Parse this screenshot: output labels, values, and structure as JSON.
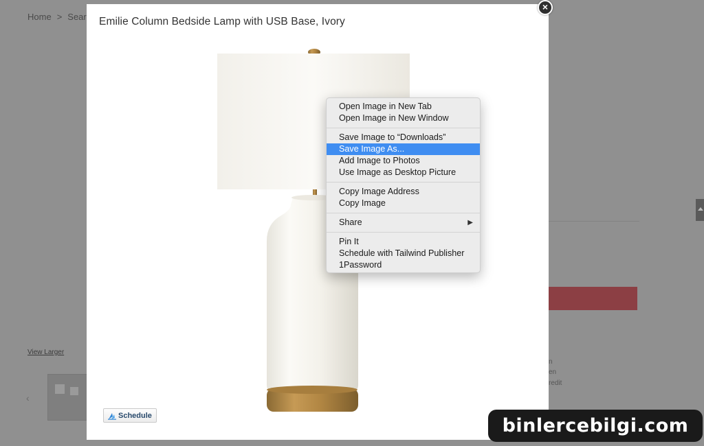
{
  "background": {
    "breadcrumb": [
      "Home",
      ">",
      "Sear"
    ],
    "view_larger": "View Larger",
    "thumb_prev": "‹",
    "side_text": [
      "n",
      "en",
      "redit"
    ],
    "accent_red": "#8c3f44"
  },
  "modal": {
    "title": "Emilie Column Bedside Lamp with USB Base, Ivory",
    "close_label": "×",
    "schedule_label": "Schedule"
  },
  "context_menu": {
    "groups": [
      [
        "Open Image in New Tab",
        "Open Image in New Window"
      ],
      [
        "Save Image to “Downloads”",
        "Save Image As...",
        "Add Image to Photos",
        "Use Image as Desktop Picture"
      ],
      [
        "Copy Image Address",
        "Copy Image"
      ],
      [
        "Share"
      ],
      [
        "Pin It",
        "Schedule with Tailwind Publisher",
        "1Password"
      ]
    ],
    "highlighted": "Save Image As...",
    "submenu_arrow": "▶",
    "highlight_color": "#3f8df1"
  },
  "watermark": "binlercebilgi.com"
}
